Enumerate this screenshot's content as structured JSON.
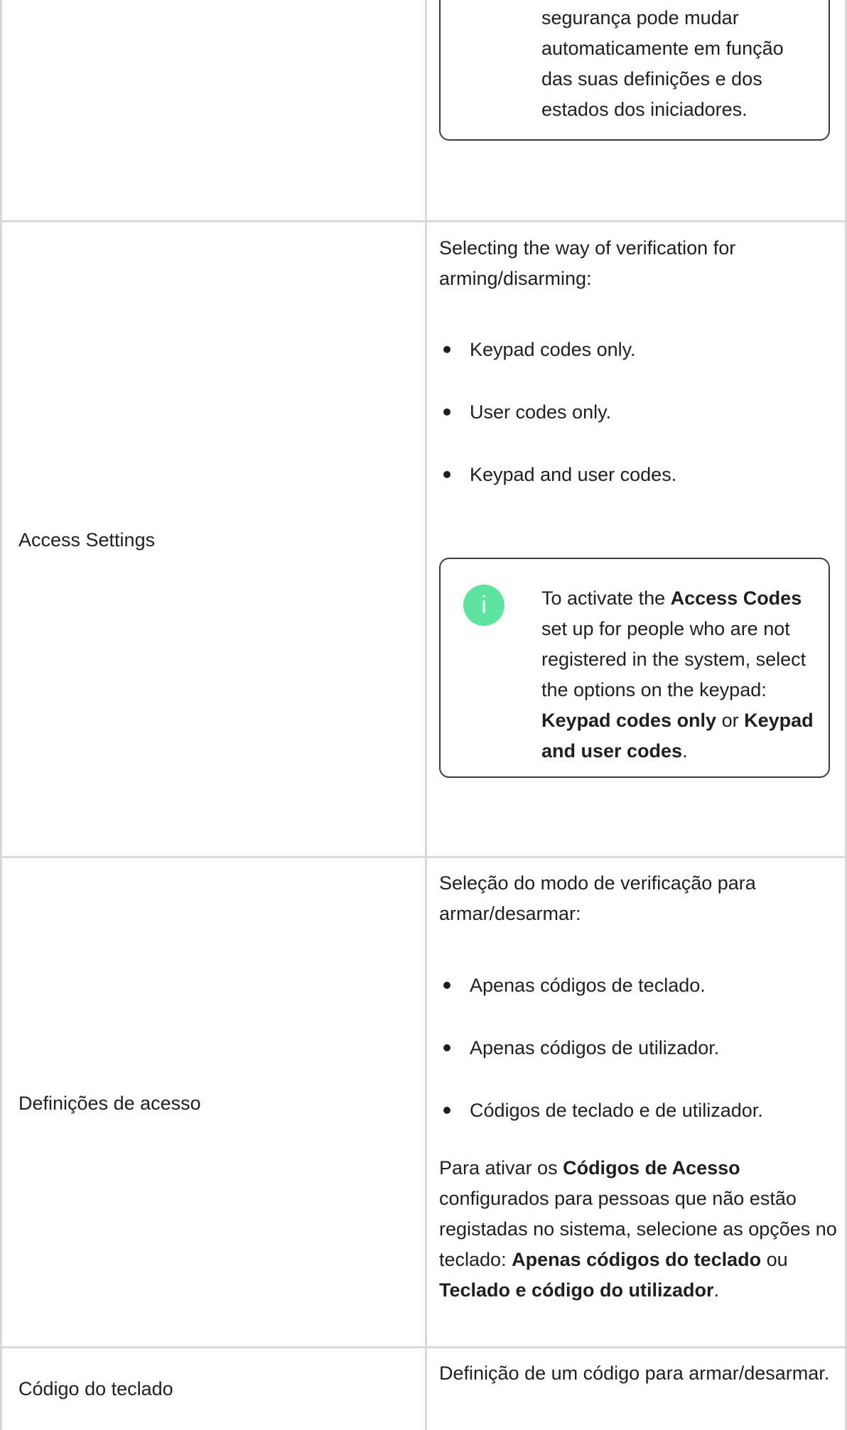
{
  "rows": [
    {
      "note_text": "segurança pode mudar automaticamente em função das suas definições e dos estados dos iniciadores."
    },
    {
      "label": "Access Settings",
      "intro": "Selecting the way of verification for arming/disarming:",
      "bullets": [
        "Keypad codes only.",
        "User codes only.",
        "Keypad and user codes."
      ],
      "note": {
        "icon": "info-icon",
        "icon_glyph": "i",
        "t1": "To activate the ",
        "b1": "Access Codes",
        "t2": " set up for people who are not registered in the system, select the options on the keypad: ",
        "b2": "Keypad codes only",
        "t3": " or ",
        "b3": "Keypad and user codes",
        "t4": "."
      }
    },
    {
      "label": "Definições de acesso",
      "intro": "Seleção do modo de verificação para armar/desarmar:",
      "bullets": [
        "Apenas códigos de teclado.",
        "Apenas códigos de utilizador.",
        "Códigos de teclado e de utilizador."
      ],
      "para": {
        "t1": "Para ativar os ",
        "b1": "Códigos de Acesso",
        "t2": " configurados para pessoas que não estão registadas no sistema, selecione as opções no teclado: ",
        "b2": "Apenas códigos do teclado",
        "t3": " ou ",
        "b3": "Teclado e código do utilizador",
        "t4": "."
      }
    },
    {
      "label": "Código do teclado",
      "desc": "Definição de um código para armar/desarmar."
    }
  ]
}
